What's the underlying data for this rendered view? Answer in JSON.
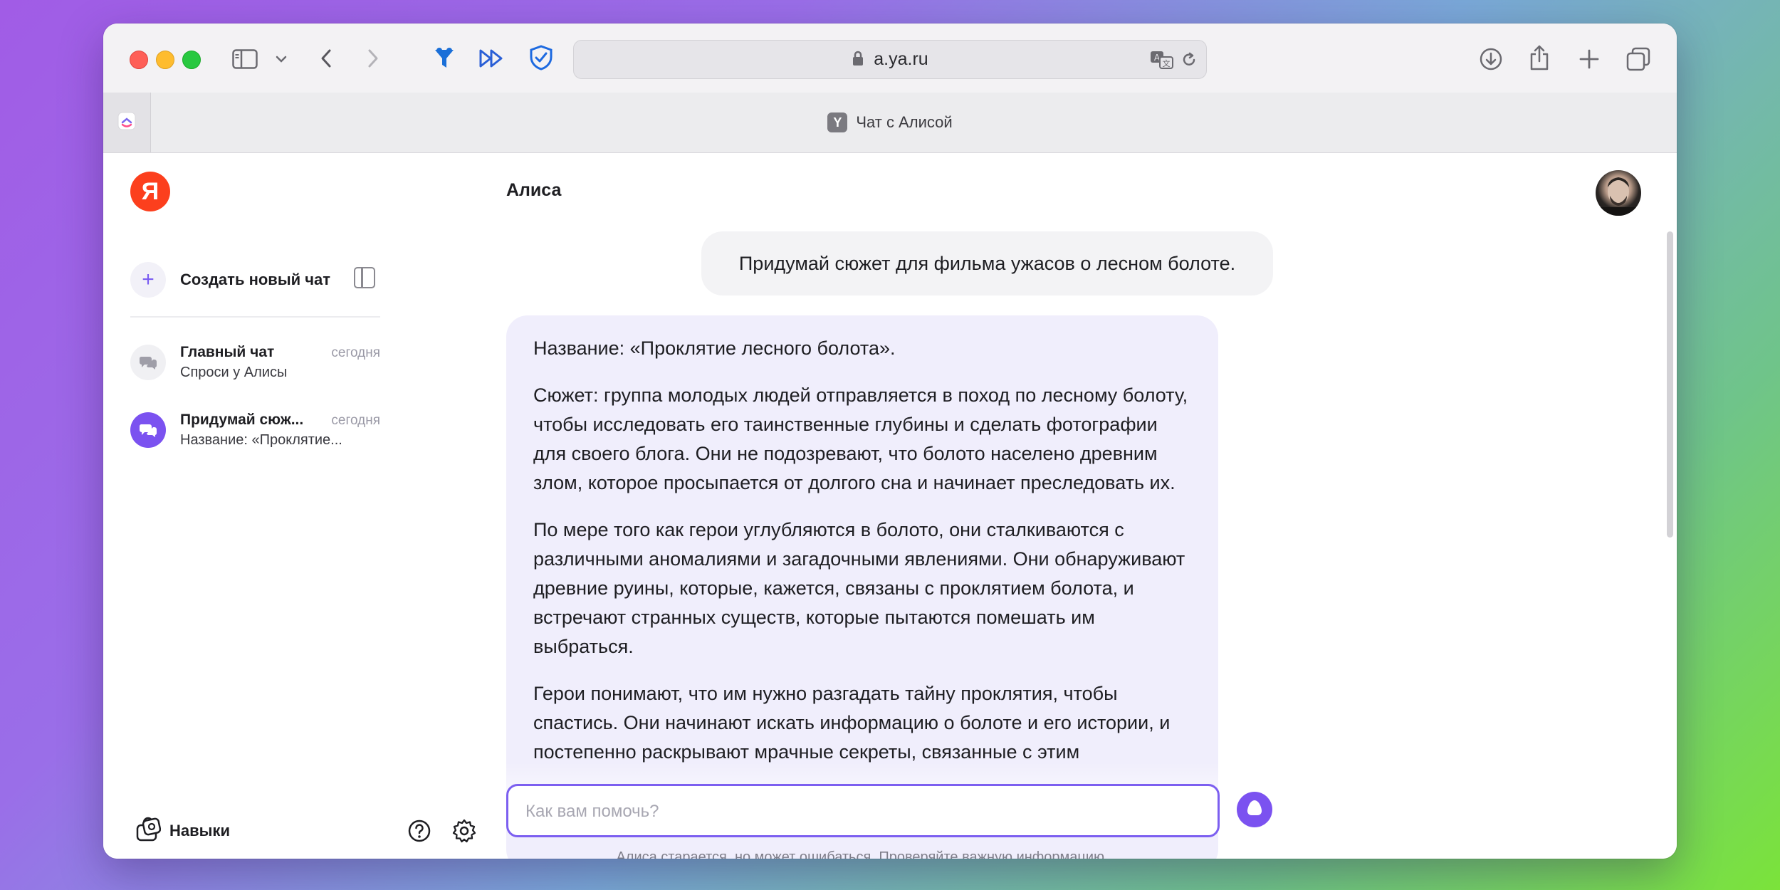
{
  "browser": {
    "url": "a.ya.ru",
    "tab_title": "Чат с Алисой",
    "tab_favicon_letter": "Y"
  },
  "sidebar": {
    "logo_letter": "Я",
    "new_chat_label": "Создать новый чат",
    "chats": [
      {
        "title": "Главный чат",
        "date": "сегодня",
        "subtitle": "Спроси у Алисы"
      },
      {
        "title": "Придумай сюж...",
        "date": "сегодня",
        "subtitle": "Название: «Проклятие..."
      }
    ],
    "skills_label": "Навыки"
  },
  "chat": {
    "header_title": "Алиса",
    "user_message": "Придумай сюжет для фильма ужасов о лесном болоте.",
    "assistant_paragraphs": [
      "Название: «Проклятие лесного болота».",
      "Сюжет: группа молодых людей отправляется в поход по лесному болоту, чтобы исследовать его таинственные глубины и сделать фотографии для своего блога. Они не подозревают, что болото населено древним злом, которое просыпается от долгого сна и начинает преследовать их.",
      "По мере того как герои углубляются в болото, они сталкиваются с различными аномалиями и загадочными явлениями. Они обнаруживают древние руины, которые, кажется, связаны с проклятием болота, и встречают странных существ, которые пытаются помешать им выбраться.",
      "Герои понимают, что им нужно разгадать тайну проклятия, чтобы спастись. Они начинают искать информацию о болоте и его истории, и постепенно раскрывают мрачные секреты, связанные с этим"
    ],
    "input_placeholder": "Как вам помочь?",
    "input_value": "",
    "disclaimer": "Алиса старается, но может ошибаться. Проверяйте важную информацию."
  },
  "colors": {
    "accent": "#7c5ff0",
    "logo_red": "#fc3f1d",
    "assistant_bubble": "#f0eefc",
    "user_bubble": "#f3f3f5"
  }
}
